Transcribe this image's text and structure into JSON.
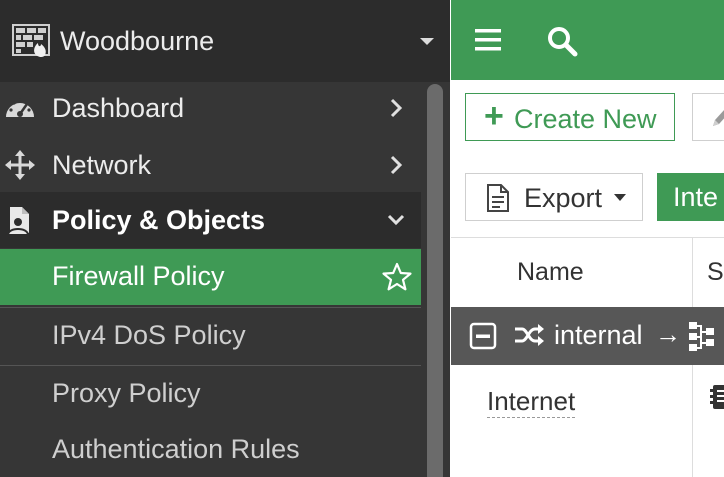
{
  "brand": {
    "name": "Woodbourne",
    "logo_icon": "fortigate-logo-icon"
  },
  "nav": [
    {
      "label": "Dashboard",
      "icon": "speedometer-icon"
    },
    {
      "label": "Network",
      "icon": "move-arrows-icon"
    },
    {
      "label": "Policy & Objects",
      "icon": "document-person-icon"
    }
  ],
  "subnav": [
    {
      "label": "Firewall Policy"
    },
    {
      "label": "IPv4 DoS Policy"
    },
    {
      "label": "Proxy Policy"
    },
    {
      "label": "Authentication Rules"
    }
  ],
  "toolbar": {
    "create_label": "Create New",
    "export_label": "Export",
    "tab_label": "Inte"
  },
  "table": {
    "col_name": "Name",
    "col_next": "S",
    "group_label": "internal",
    "group_arrow": "→",
    "row_name": "Internet"
  },
  "colors": {
    "accent": "#3f9a55",
    "sidebar": "#363636",
    "sidebar_dark": "#2c2c2c",
    "group_row": "#575757"
  }
}
